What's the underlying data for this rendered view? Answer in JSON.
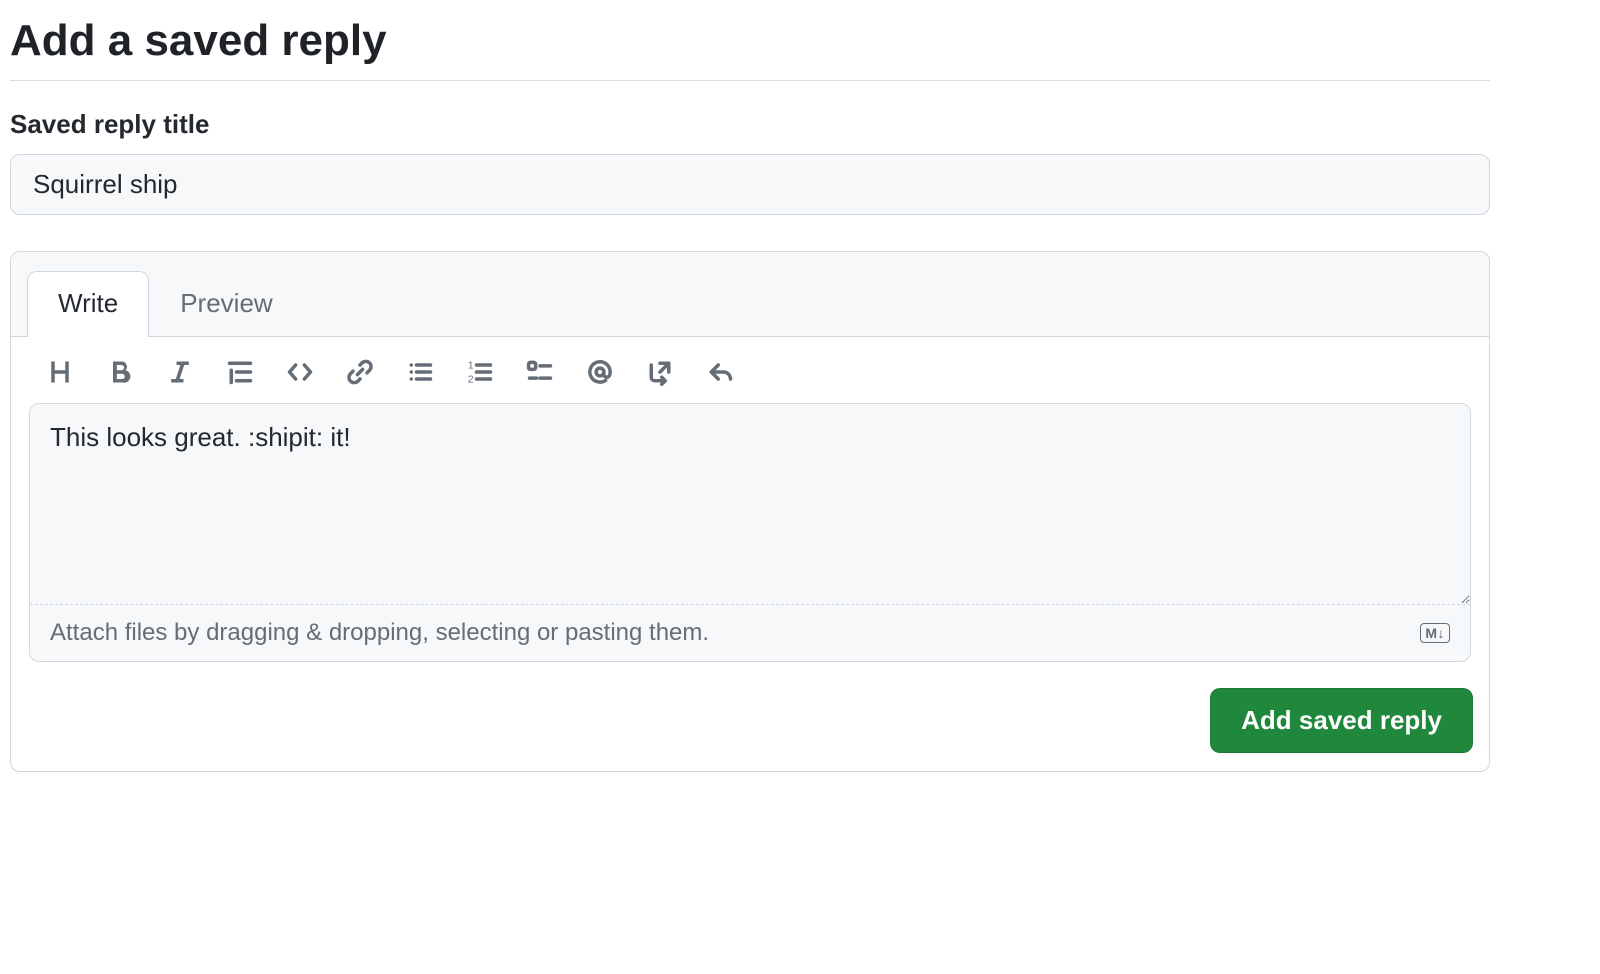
{
  "heading": "Add a saved reply",
  "title_field": {
    "label": "Saved reply title",
    "value": "Squirrel ship"
  },
  "editor": {
    "tabs": {
      "write": "Write",
      "preview": "Preview",
      "active": "write"
    },
    "toolbar": {
      "heading": "Heading",
      "bold": "Bold",
      "italic": "Italic",
      "quote": "Quote",
      "code": "Code",
      "link": "Link",
      "ul": "Unordered list",
      "ol": "Numbered list",
      "tasklist": "Task list",
      "mention": "Mention",
      "reference": "Reference issue",
      "reply": "Saved reply"
    },
    "body_value": "This looks great. :shipit: it!",
    "attach_hint": "Attach files by dragging & dropping, selecting or pasting them.",
    "markdown_badge": "M↓"
  },
  "submit_label": "Add saved reply"
}
